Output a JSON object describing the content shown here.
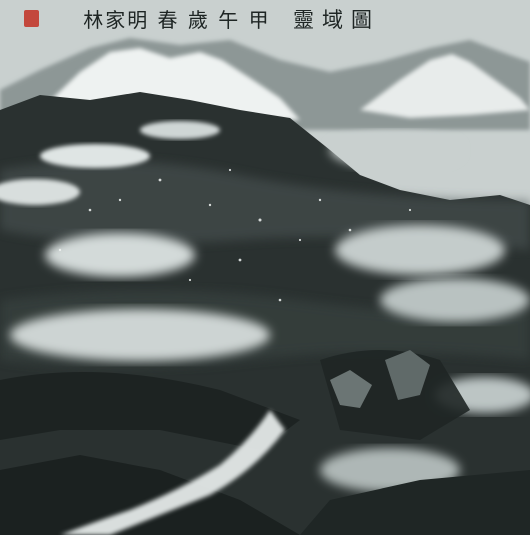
{
  "painting": {
    "inscription": "林家明 春 歲 午 甲",
    "title": "靈域圖",
    "palette": {
      "paper": "#c9d0cf",
      "ink_dark": "#1b2120",
      "ink_mid": "#4e5756",
      "snow": "#eef2f1",
      "seal_red": "#c3473c"
    }
  }
}
